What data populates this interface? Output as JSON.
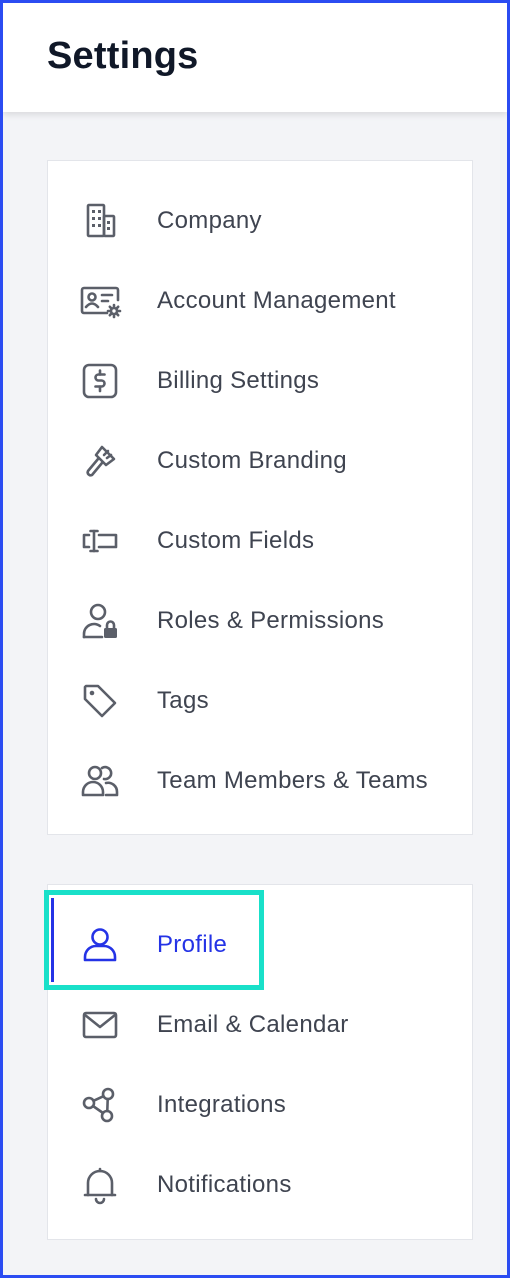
{
  "header": {
    "title": "Settings"
  },
  "groups": [
    {
      "items": [
        {
          "label": "Company",
          "icon": "building-icon"
        },
        {
          "label": "Account Management",
          "icon": "id-card-gear-icon"
        },
        {
          "label": "Billing Settings",
          "icon": "dollar-box-icon"
        },
        {
          "label": "Custom Branding",
          "icon": "paintbrush-icon"
        },
        {
          "label": "Custom Fields",
          "icon": "text-field-icon"
        },
        {
          "label": "Roles & Permissions",
          "icon": "user-lock-icon"
        },
        {
          "label": "Tags",
          "icon": "tag-icon"
        },
        {
          "label": "Team Members & Teams",
          "icon": "users-icon"
        }
      ]
    },
    {
      "items": [
        {
          "label": "Profile",
          "icon": "user-icon",
          "active": true
        },
        {
          "label": "Email & Calendar",
          "icon": "envelope-icon"
        },
        {
          "label": "Integrations",
          "icon": "share-nodes-icon"
        },
        {
          "label": "Notifications",
          "icon": "bell-icon"
        }
      ]
    }
  ],
  "colors": {
    "accent": "#2433e6",
    "highlight": "#19e0c9",
    "frame": "#2b4cf2",
    "text": "#3f4450",
    "icon": "#5b5f69"
  }
}
